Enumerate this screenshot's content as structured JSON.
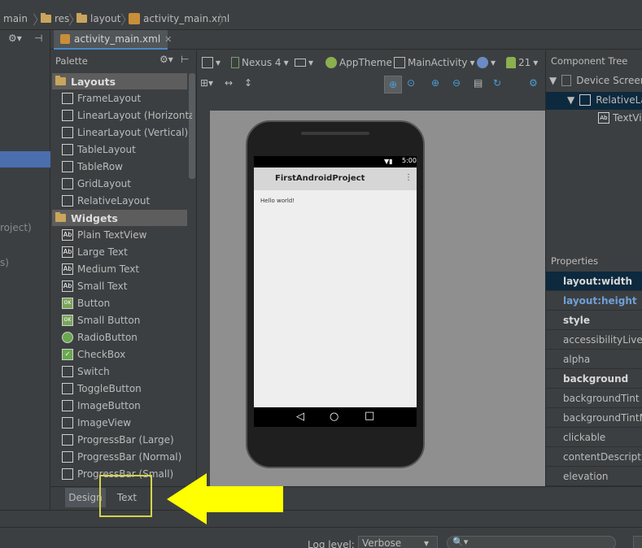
{
  "breadcrumb": [
    "main",
    "res",
    "layout",
    "activity_main.xml"
  ],
  "editor_tab": "activity_main.xml",
  "palette": {
    "title": "Palette",
    "categories": [
      {
        "name": "Layouts",
        "items": [
          "FrameLayout",
          "LinearLayout (Horizontal)",
          "LinearLayout (Vertical)",
          "TableLayout",
          "TableRow",
          "GridLayout",
          "RelativeLayout"
        ]
      },
      {
        "name": "Widgets",
        "items": [
          "Plain TextView",
          "Large Text",
          "Medium Text",
          "Small Text",
          "Button",
          "Small Button",
          "RadioButton",
          "CheckBox",
          "Switch",
          "ToggleButton",
          "ImageButton",
          "ImageView",
          "ProgressBar (Large)",
          "ProgressBar (Normal)",
          "ProgressBar (Small)"
        ]
      }
    ]
  },
  "toolbar": {
    "device": "Nexus 4",
    "theme": "AppTheme",
    "activity": "MainActivity",
    "api": "21"
  },
  "phone": {
    "time": "5:00",
    "app_title": "FirstAndroidProject",
    "content_text": "Hello world!"
  },
  "component_tree": {
    "title": "Component Tree",
    "nodes": [
      "Device Screen",
      "RelativeLayout",
      "TextView"
    ]
  },
  "properties": {
    "title": "Properties",
    "rows": [
      {
        "name": "layout:width",
        "style": "bold-selected"
      },
      {
        "name": "layout:height",
        "style": "bold-blue"
      },
      {
        "name": "style",
        "style": "bold"
      },
      {
        "name": "accessibilityLiveRegion",
        "style": "normal"
      },
      {
        "name": "alpha",
        "style": "normal"
      },
      {
        "name": "background",
        "style": "bold"
      },
      {
        "name": "backgroundTint",
        "style": "normal"
      },
      {
        "name": "backgroundTintMode",
        "style": "normal"
      },
      {
        "name": "clickable",
        "style": "normal"
      },
      {
        "name": "contentDescription",
        "style": "normal"
      },
      {
        "name": "elevation",
        "style": "normal"
      }
    ]
  },
  "bottom_tabs": {
    "design": "Design",
    "text": "Text"
  },
  "left_stub": {
    "item1": "roject)",
    "item2": "s)"
  },
  "log": {
    "label": "Log level:",
    "value": "Verbose",
    "search_icon": "search-icon"
  },
  "annotation": {
    "arrow_color": "#ffff00",
    "highlight_color": "#d4d44a"
  }
}
